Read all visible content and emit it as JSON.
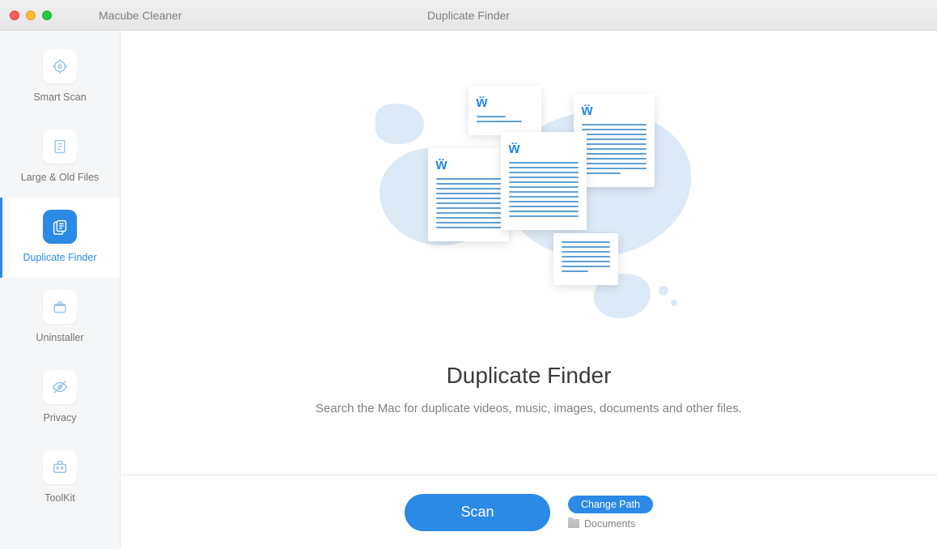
{
  "titlebar": {
    "app_name": "Macube Cleaner",
    "window_title": "Duplicate Finder"
  },
  "sidebar": {
    "items": [
      {
        "label": "Smart Scan",
        "icon": "target-icon"
      },
      {
        "label": "Large & Old Files",
        "icon": "file-icon"
      },
      {
        "label": "Duplicate Finder",
        "icon": "duplicate-icon",
        "active": true
      },
      {
        "label": "Uninstaller",
        "icon": "package-icon"
      },
      {
        "label": "Privacy",
        "icon": "eye-off-icon"
      },
      {
        "label": "ToolKit",
        "icon": "toolkit-icon"
      }
    ]
  },
  "main": {
    "title": "Duplicate Finder",
    "subtitle": "Search the Mac for duplicate videos, music, images, documents and other files.",
    "scan_button": "Scan",
    "change_path_button": "Change Path",
    "current_path": "Documents"
  }
}
